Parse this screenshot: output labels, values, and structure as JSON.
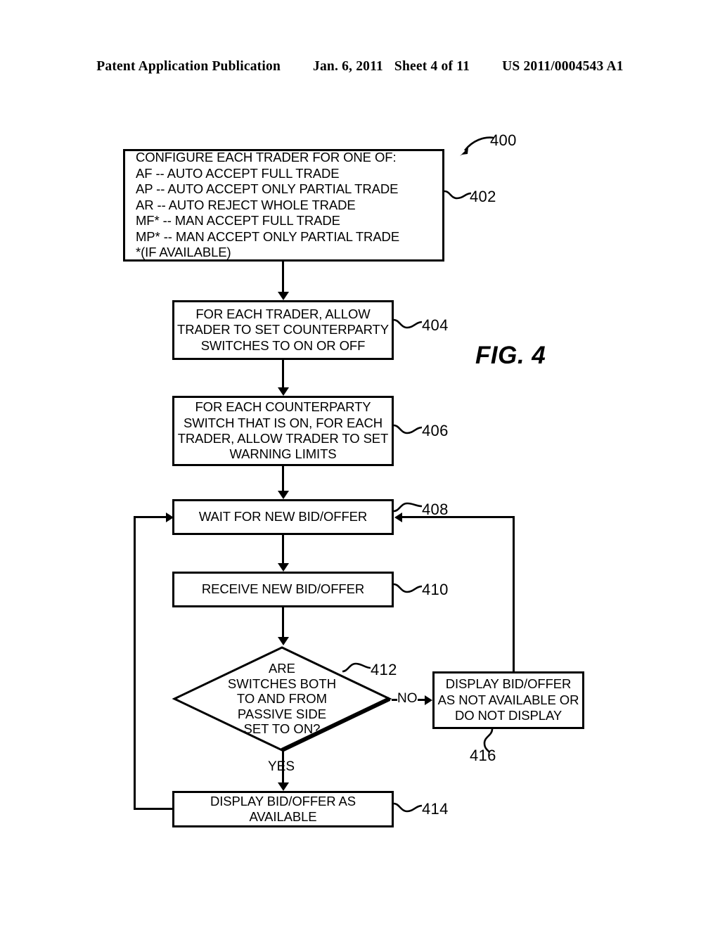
{
  "header": {
    "publication": "Patent Application Publication",
    "date": "Jan. 6, 2011",
    "sheet": "Sheet 4 of 11",
    "patent_number": "US 2011/0004543 A1"
  },
  "figure": {
    "label": "FIG. 4",
    "top_reference": "400"
  },
  "flowchart": {
    "nodes": [
      {
        "ref": "402",
        "shape": "process",
        "text": "CONFIGURE EACH TRADER FOR ONE OF:\nAF -- AUTO ACCEPT FULL TRADE\nAP -- AUTO ACCEPT ONLY PARTIAL TRADE\nAR -- AUTO REJECT WHOLE TRADE\nMF* -- MAN ACCEPT FULL TRADE\nMP* -- MAN ACCEPT ONLY PARTIAL TRADE\n*(IF AVAILABLE)"
      },
      {
        "ref": "404",
        "shape": "process",
        "text": "FOR EACH TRADER, ALLOW\nTRADER TO SET COUNTERPARTY\nSWITCHES TO ON OR OFF"
      },
      {
        "ref": "406",
        "shape": "process",
        "text": "FOR EACH COUNTERPARTY\nSWITCH THAT IS ON, FOR EACH\nTRADER, ALLOW TRADER TO SET\nWARNING LIMITS"
      },
      {
        "ref": "408",
        "shape": "process",
        "text": "WAIT FOR NEW BID/OFFER"
      },
      {
        "ref": "410",
        "shape": "process",
        "text": "RECEIVE NEW BID/OFFER"
      },
      {
        "ref": "412",
        "shape": "decision",
        "text": "ARE\nSWITCHES BOTH\nTO AND FROM\nPASSIVE SIDE\nSET TO ON?"
      },
      {
        "ref": "414",
        "shape": "process",
        "text": "DISPLAY BID/OFFER AS\nAVAILABLE"
      },
      {
        "ref": "416",
        "shape": "process",
        "text": "DISPLAY BID/OFFER\nAS NOT AVAILABLE OR\nDO NOT DISPLAY"
      }
    ],
    "branch_labels": {
      "yes": "YES",
      "no": "NO"
    }
  }
}
